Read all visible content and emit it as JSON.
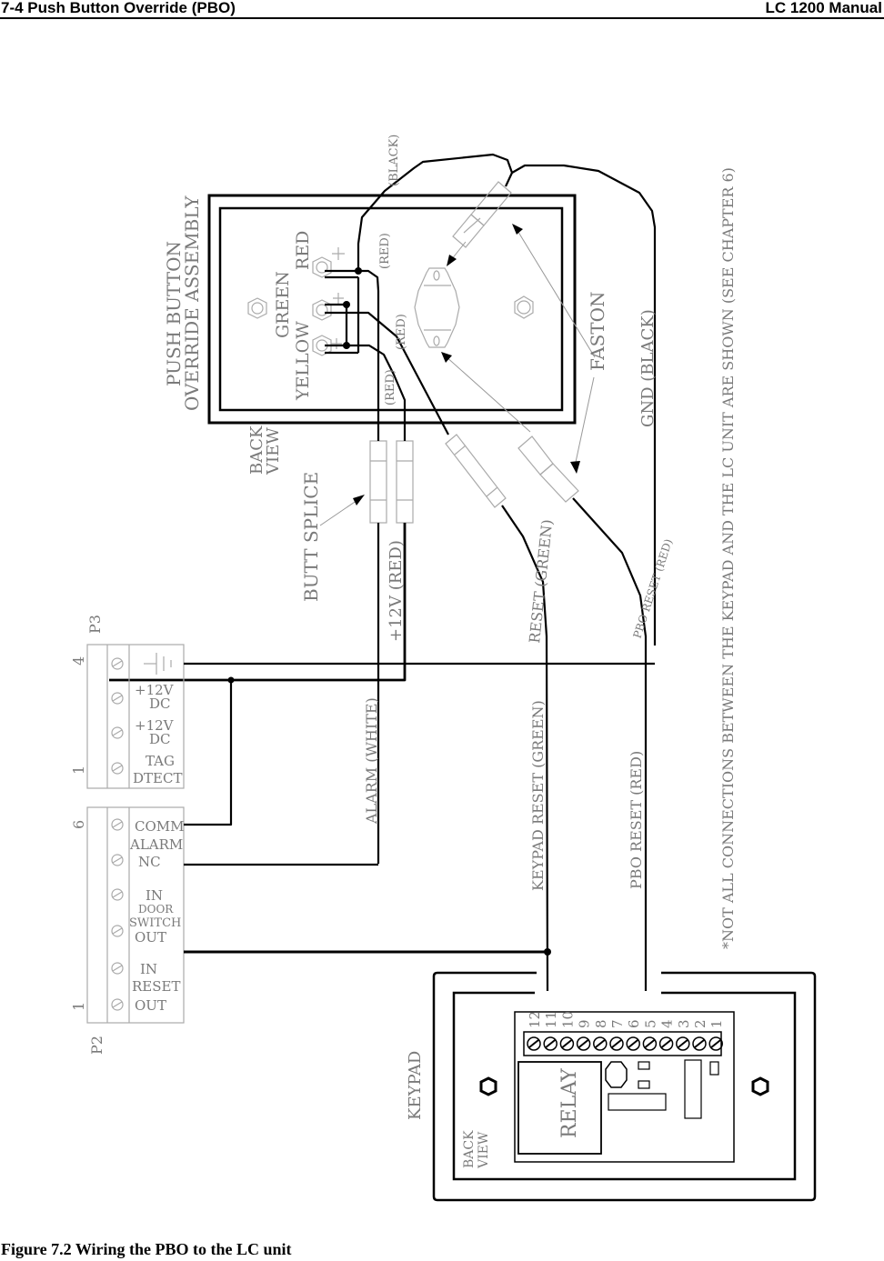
{
  "header": {
    "section_title": "7-4 Push Button Override (PBO)",
    "manual_title": "LC 1200 Manual"
  },
  "caption": "Figure 7.2 Wiring the PBO to the LC unit",
  "diagram": {
    "pbo_assembly": {
      "title_line1": "PUSH BUTTON",
      "title_line2": "OVERRIDE ASSEMBLY",
      "view_line1": "BACK",
      "view_line2": "VIEW",
      "buttons": [
        "YELLOW",
        "GREEN",
        "RED"
      ]
    },
    "wire_labels": {
      "black_top": "(BLACK)",
      "red_1": "(RED)",
      "red_2": "(RED)",
      "red_3": "(RED)",
      "faston": "FASTON",
      "gnd": "GND (BLACK)",
      "butt_splice": "BUTT SPLICE",
      "plus12v": "+12V (RED)",
      "reset_green": "RESET (GREEN)",
      "pbo_reset_red": "PBO RESET (RED)",
      "alarm_white": "ALARM (WHITE)",
      "keypad_reset_green": "KEYPAD RESET (GREEN)",
      "pbo_reset_red_long": "PBO RESET (RED)"
    },
    "note": "*NOT ALL CONNECTIONS BETWEEN THE KEYPAD AND THE LC UNIT ARE SHOWN (SEE CHAPTER 6)",
    "p3": {
      "name": "P3",
      "pin_high": "4",
      "pin_low": "1",
      "terminals": [
        "GND",
        "+12V DC",
        "+12V DC",
        "TAG DTECT"
      ],
      "labels": {
        "t2a": "+12V",
        "t2b": "DC",
        "t3a": "+12V",
        "t3b": "DC",
        "t4a": "TAG",
        "t4b": "DTECT"
      }
    },
    "p2": {
      "name": "P2",
      "pin_high": "6",
      "pin_low": "1",
      "labels": {
        "comm": "COMM",
        "alarm": "ALARM",
        "nc": "NC",
        "in1": "IN",
        "door": "DOOR",
        "switch": "SWITCH",
        "out1": "OUT",
        "in2": "IN",
        "reset": "RESET",
        "out2": "OUT"
      }
    },
    "keypad": {
      "title": "KEYPAD",
      "view_line1": "BACK",
      "view_line2": "VIEW",
      "relay": "RELAY",
      "terminal_numbers": [
        "12",
        "11",
        "10",
        "9",
        "8",
        "7",
        "6",
        "5",
        "4",
        "3",
        "2",
        "1"
      ]
    }
  }
}
